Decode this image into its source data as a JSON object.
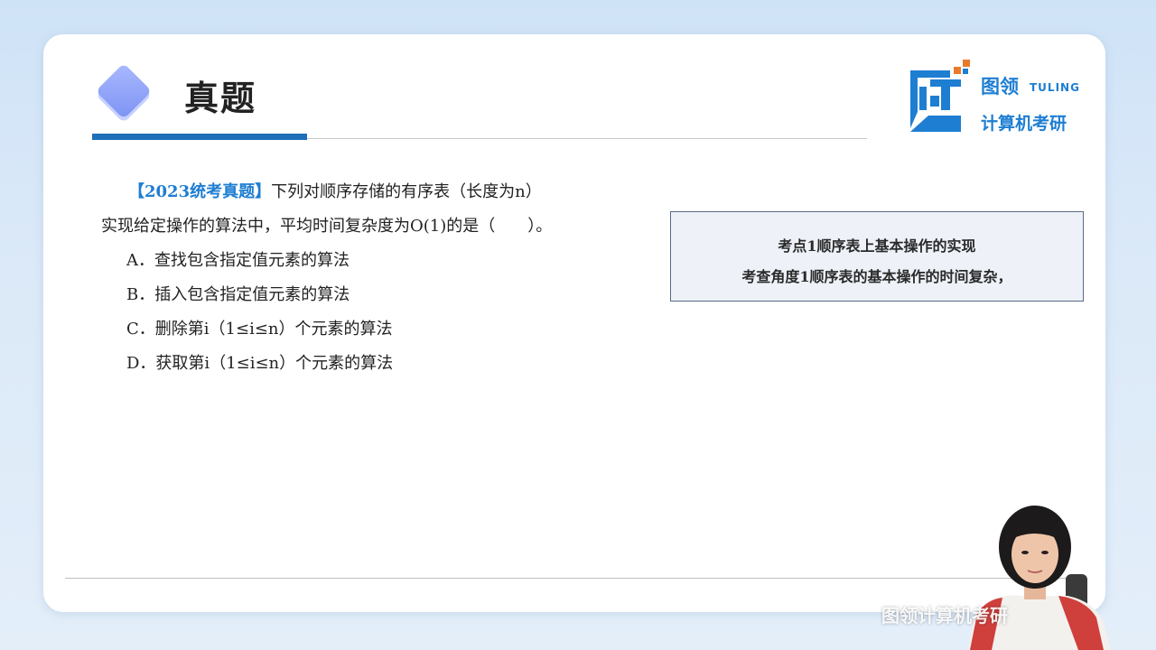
{
  "slide": {
    "title": "真题"
  },
  "logo": {
    "name": "图领",
    "english": "TULING",
    "subtitle": "计算机考研"
  },
  "question": {
    "tag": "【2023统考真题】",
    "line1": "下列对顺序存储的有序表（长度为n）",
    "line2": "实现给定操作的算法中，平均时间复杂度为O(1)的是（　　）。",
    "options": [
      "A．查找包含指定值元素的算法",
      "B．插入包含指定值元素的算法",
      "C．删除第i（1≤i≤n）个元素的算法",
      "D．获取第i（1≤i≤n）个元素的算法"
    ]
  },
  "knowledge_box": {
    "line1": "考点1顺序表上基本操作的实现",
    "line2": "考查角度1顺序表的基本操作的时间复杂，"
  },
  "watermark": "图领计算机考研",
  "colors": {
    "accent_blue": "#1e7ed2",
    "underline_blue": "#1f6fb8",
    "box_border": "#5a6a86"
  }
}
